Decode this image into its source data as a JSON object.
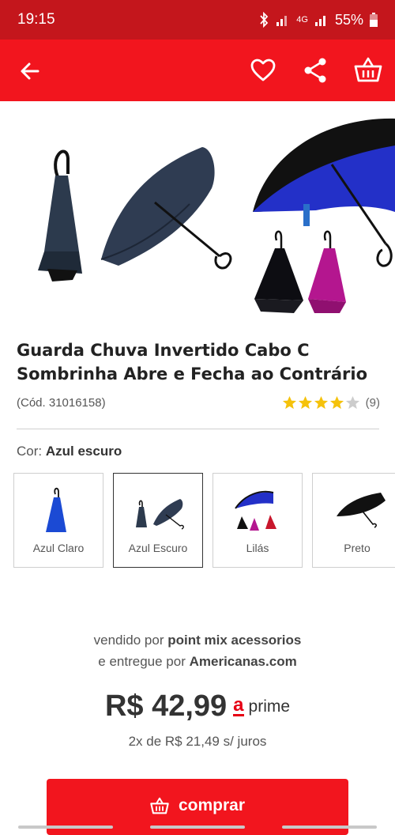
{
  "status_bar": {
    "time": "19:15",
    "network": "4G",
    "battery": "55%"
  },
  "app_bar": {
    "back_icon": "arrow-left-icon",
    "favorite_icon": "heart-icon",
    "share_icon": "share-icon",
    "cart_icon": "basket-icon"
  },
  "product": {
    "title_line1": "Guarda Chuva Invertido Cabo C",
    "title_line2": "Sombrinha Abre e Fecha ao Contrário",
    "code": "(Cód. 31016158)",
    "rating": 4,
    "rating_max": 5,
    "rating_count": "(9)"
  },
  "color_selector": {
    "label": "Cor:",
    "selected": "Azul escuro",
    "options": [
      {
        "label": "Azul Claro"
      },
      {
        "label": "Azul Escuro"
      },
      {
        "label": "Lilás"
      },
      {
        "label": "Preto"
      }
    ]
  },
  "seller": {
    "sold_by_prefix": "vendido por",
    "sold_by": "point mix acessorios",
    "delivered_by_prefix": "e entregue por",
    "delivered_by": "Americanas.com"
  },
  "pricing": {
    "price": "R$ 42,99",
    "prime_logo_letter": "a",
    "prime_label": "prime",
    "installments": "2x de R$ 21,49 s/ juros"
  },
  "buy": {
    "label": "comprar"
  },
  "colors": {
    "status_bar": "#c4161c",
    "app_bar": "#f2151e",
    "star_filled": "#f5c20b",
    "star_empty": "#cccccc"
  }
}
